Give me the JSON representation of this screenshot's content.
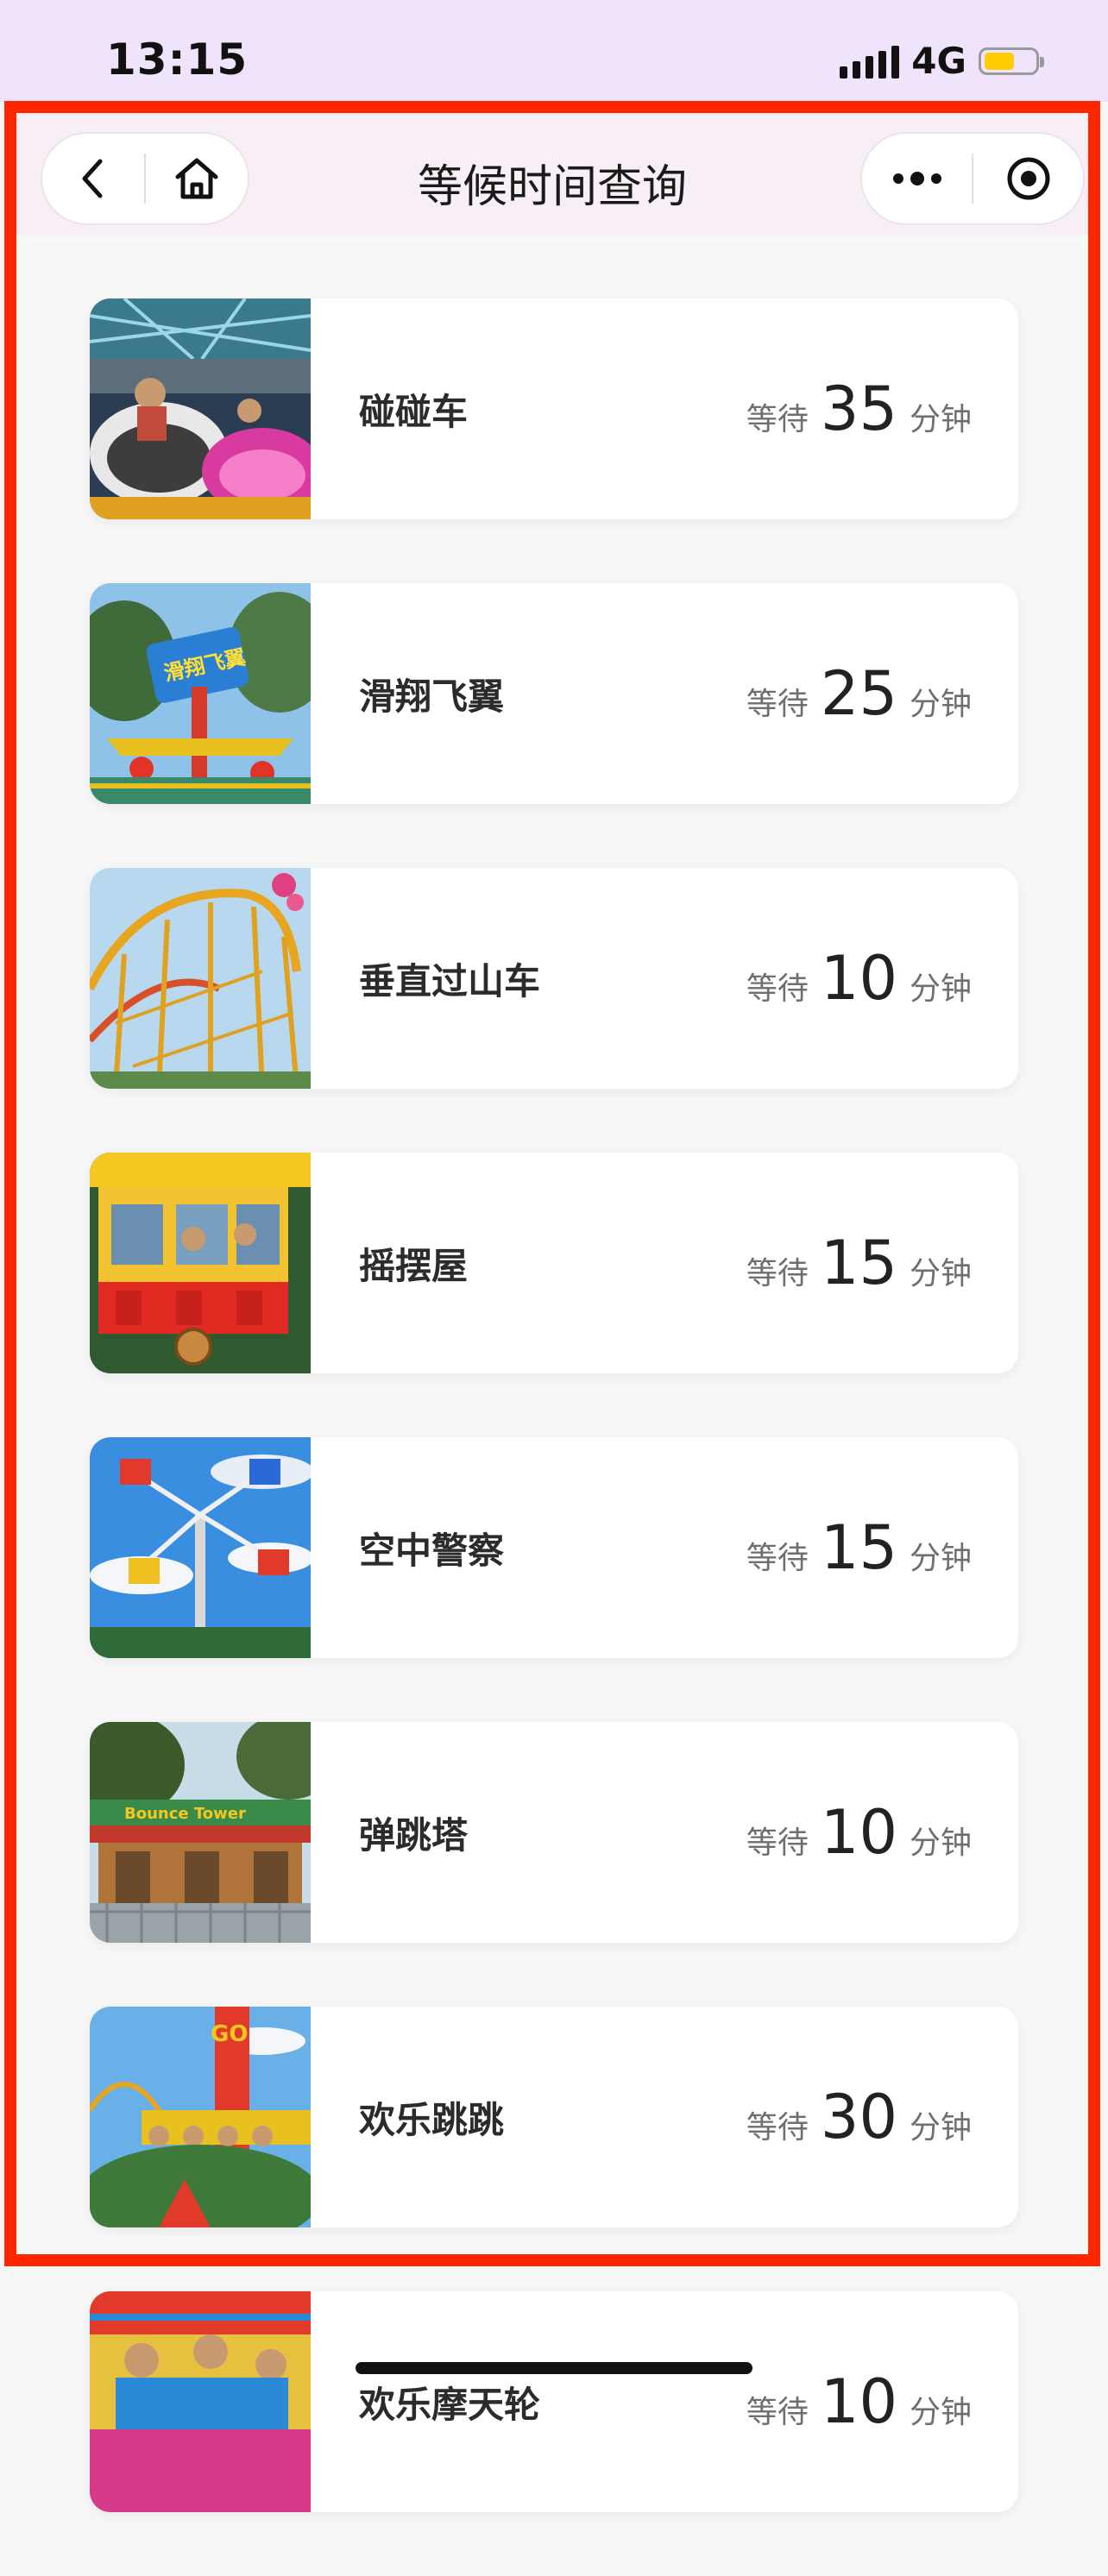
{
  "status_bar": {
    "time": "13:15",
    "network": "4G",
    "battery_level": 0.55,
    "battery_color": "#ffcc00"
  },
  "nav": {
    "title": "等候时间查询",
    "back_icon": "chevron-left-icon",
    "home_icon": "home-icon",
    "more_icon": "more-dots-icon",
    "capsule_icon": "target-icon"
  },
  "highlight_color": "#ff2600",
  "rides": [
    {
      "name": "碰碰车",
      "wait_prefix": "等待",
      "wait_minutes": "35",
      "wait_unit": "分钟",
      "thumb": "bumper-cars"
    },
    {
      "name": "滑翔飞翼",
      "wait_prefix": "等待",
      "wait_minutes": "25",
      "wait_unit": "分钟",
      "thumb": "glider-wings"
    },
    {
      "name": "垂直过山车",
      "wait_prefix": "等待",
      "wait_minutes": "10",
      "wait_unit": "分钟",
      "thumb": "roller-coaster"
    },
    {
      "name": "摇摆屋",
      "wait_prefix": "等待",
      "wait_minutes": "15",
      "wait_unit": "分钟",
      "thumb": "swing-house"
    },
    {
      "name": "空中警察",
      "wait_prefix": "等待",
      "wait_minutes": "15",
      "wait_unit": "分钟",
      "thumb": "sky-police"
    },
    {
      "name": "弹跳塔",
      "wait_prefix": "等待",
      "wait_minutes": "10",
      "wait_unit": "分钟",
      "thumb": "bounce-tower"
    },
    {
      "name": "欢乐跳跳",
      "wait_prefix": "等待",
      "wait_minutes": "30",
      "wait_unit": "分钟",
      "thumb": "happy-jump"
    },
    {
      "name": "欢乐摩天轮",
      "wait_prefix": "等待",
      "wait_minutes": "10",
      "wait_unit": "分钟",
      "thumb": "ferris-wheel"
    }
  ]
}
